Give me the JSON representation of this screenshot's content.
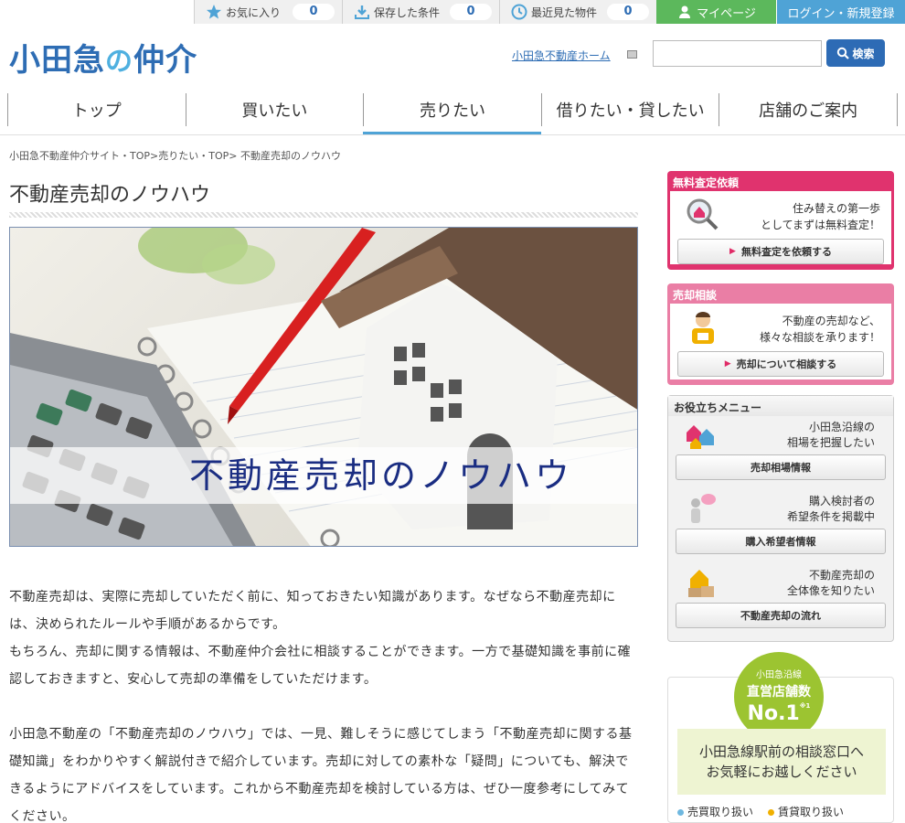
{
  "util": {
    "favorites_label": "お気に入り",
    "favorites_count": "0",
    "saved_label": "保存した条件",
    "saved_count": "0",
    "recent_label": "最近見た物件",
    "recent_count": "0",
    "mypage_label": "マイページ",
    "login_label": "ログイン・新規登録"
  },
  "header": {
    "logo_part1": "小田急",
    "logo_part2": "の",
    "logo_part3": "仲介",
    "home_link": "小田急不動産ホーム",
    "search_placeholder": "",
    "search_button": "検索"
  },
  "nav": {
    "items": [
      {
        "label": "トップ"
      },
      {
        "label": "買いたい"
      },
      {
        "label": "売りたい"
      },
      {
        "label": "借りたい・貸したい"
      },
      {
        "label": "店舗のご案内"
      }
    ]
  },
  "breadcrumb": "小田急不動産仲介サイト・TOP>売りたい・TOP> 不動産売却のノウハウ",
  "main": {
    "title": "不動産売却のノウハウ",
    "hero_text": "不動産売却のノウハウ",
    "paragraph1": "不動産売却は、実際に売却していただく前に、知っておきたい知識があります。なぜなら不動産売却には、決められたルールや手順があるからです。\nもちろん、売却に関する情報は、不動産仲介会社に相談することができます。一方で基礎知識を事前に確認しておきますと、安心して売却の準備をしていただけます。",
    "paragraph2": "小田急不動産の「不動産売却のノウハウ」では、一見、難しそうに感じてしまう「不動産売却に関する基礎知識」をわかりやすく解説付きで紹介しています。売却に対しての素朴な「疑問」についても、解決できるようにアドバイスをしています。これから不動産売却を検討している方は、ぜひ一度参考にしてみてください。"
  },
  "sidebar": {
    "free": {
      "head": "無料査定依頼",
      "msg1": "住み替えの第一歩",
      "msg2": "としてまずは無料査定！",
      "button": "無料査定を依頼する"
    },
    "consult": {
      "head": "売却相談",
      "msg1": "不動産の売却など、",
      "msg2": "様々な相談を承ります！",
      "button": "売却について相談する"
    },
    "menu": {
      "head": "お役立ちメニュー",
      "items": [
        {
          "msg1": "小田急沿線の",
          "msg2": "相場を把握したい",
          "button": "売却相場情報"
        },
        {
          "msg1": "購入検討者の",
          "msg2": "希望条件を掲載中",
          "button": "購入希望者情報"
        },
        {
          "msg1": "不動産売却の",
          "msg2": "全体像を知りたい",
          "button": "不動産売却の流れ"
        }
      ]
    },
    "rank": {
      "line1": "小田急沿線",
      "line2": "直営店舗数",
      "line3": "No.1",
      "note": "※1",
      "panel1": "小田急線駅前の相談窓口へ",
      "panel2": "お気軽にお越しください",
      "legend1": "売買取り扱い",
      "legend2": "賃貸取り扱い",
      "legend1_color": "#6fb8e0",
      "legend2_color": "#f0b000"
    }
  }
}
